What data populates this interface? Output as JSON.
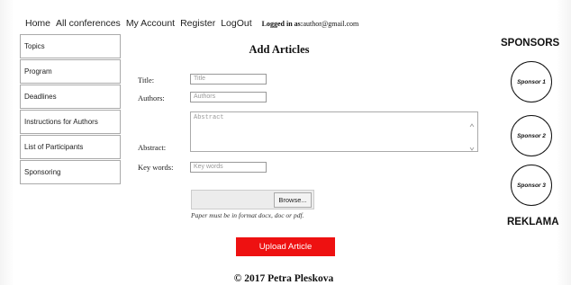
{
  "nav": {
    "home": "Home",
    "conferences": "All conferences",
    "account": "My Account",
    "register": "Register",
    "logout": "LogOut",
    "login_label": "Logged in as:",
    "login_email": "author@gmail.com"
  },
  "sidebar": {
    "items": [
      {
        "label": "Topics"
      },
      {
        "label": "Program"
      },
      {
        "label": "Deadlines"
      },
      {
        "label": "Instructions for Authors"
      },
      {
        "label": "List of Participants"
      },
      {
        "label": "Sponsoring"
      }
    ]
  },
  "form": {
    "heading": "Add Articles",
    "title_label": "Title:",
    "title_placeholder": "Title",
    "authors_label": "Authors:",
    "authors_placeholder": "Authors",
    "abstract_label": "Abstract:",
    "abstract_placeholder": "Abstract",
    "keywords_label": "Key words:",
    "keywords_placeholder": "Key words",
    "browse_label": "Browse...",
    "format_note": "Paper must be in format docx, doc or pdf.",
    "upload_label": "Upload Article"
  },
  "sponsors": {
    "title": "SPONSORS",
    "items": [
      "Sponsor 1",
      "Sponsor 2",
      "Sponsor 3"
    ],
    "reklama": "REKLAMA"
  },
  "footer": "© 2017 Petra Pleskova",
  "colors": {
    "upload_button": "#ee1111"
  }
}
